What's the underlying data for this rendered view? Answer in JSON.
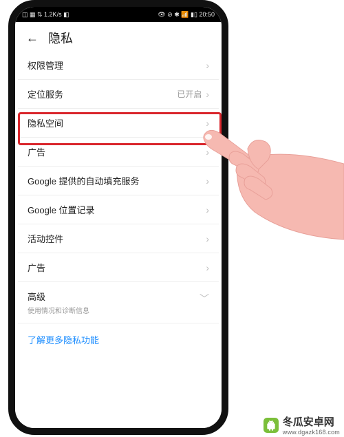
{
  "status": {
    "left": "◫ ▦ ⇅ 1.2K/s ◧",
    "right": "👁 ⊘ ✱ 📶 ▮▯ 20:50"
  },
  "header": {
    "back_glyph": "←",
    "title": "隐私"
  },
  "rows": {
    "permissions": {
      "label": "权限管理"
    },
    "location": {
      "label": "定位服务",
      "value": "已开启"
    },
    "private_space": {
      "label": "隐私空间"
    },
    "ads1": {
      "label": "广告"
    },
    "google_autofill": {
      "label": "Google 提供的自动填充服务"
    },
    "google_location": {
      "label": "Google 位置记录"
    },
    "activity_widgets": {
      "label": "活动控件"
    },
    "ads2": {
      "label": "广告"
    },
    "advanced": {
      "label": "高级",
      "sub": "使用情况和诊断信息"
    },
    "learn_more": {
      "label": "了解更多隐私功能"
    }
  },
  "chevron": "›",
  "chevron_down": "﹀",
  "watermark": {
    "name": "冬瓜安卓网",
    "url": "www.dgazk168.com"
  }
}
